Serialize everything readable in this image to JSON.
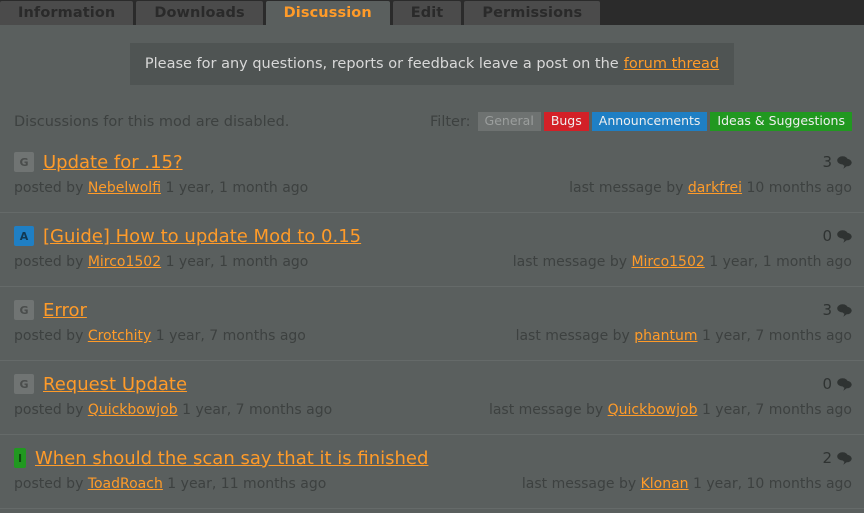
{
  "tabs": [
    {
      "label": "Information",
      "active": false
    },
    {
      "label": "Downloads",
      "active": false
    },
    {
      "label": "Discussion",
      "active": true
    },
    {
      "label": "Edit",
      "active": false
    },
    {
      "label": "Permissions",
      "active": false
    }
  ],
  "banner": {
    "text": "Please for any questions, reports or feedback leave a post on the",
    "link_text": "forum thread"
  },
  "filter": {
    "disabled_note": "Discussions for this mod are disabled.",
    "label": "Filter:",
    "tags": [
      {
        "label": "General",
        "kind": "general",
        "color": "#6e7271",
        "active": false
      },
      {
        "label": "Bugs",
        "kind": "bugs",
        "color": "#d32027",
        "active": true
      },
      {
        "label": "Announcements",
        "kind": "announce",
        "color": "#1f7fc4",
        "active": true
      },
      {
        "label": "Ideas & Suggestions",
        "kind": "ideas",
        "color": "#219820",
        "active": true
      }
    ]
  },
  "colors": {
    "accent": "#ff9b29",
    "page_bg": "#5a5f5e",
    "tabbar_bg": "#2b2b2b",
    "banner_bg": "#4f5453"
  },
  "threads": [
    {
      "badge": "G",
      "badge_kind": "g",
      "title": "Update for .15?",
      "posted_prefix": "posted by",
      "posted_user": "Nebelwolfi",
      "posted_time": "1 year, 1 month ago",
      "reply_count": "3",
      "last_prefix": "last message by",
      "last_user": "darkfrei",
      "last_time": "10 months ago"
    },
    {
      "badge": "A",
      "badge_kind": "a",
      "title": "[Guide] How to update Mod to 0.15",
      "posted_prefix": "posted by",
      "posted_user": "Mirco1502",
      "posted_time": "1 year, 1 month ago",
      "reply_count": "0",
      "last_prefix": "last message by",
      "last_user": "Mirco1502",
      "last_time": "1 year, 1 month ago"
    },
    {
      "badge": "G",
      "badge_kind": "g",
      "title": "Error",
      "posted_prefix": "posted by",
      "posted_user": "Crotchity",
      "posted_time": "1 year, 7 months ago",
      "reply_count": "3",
      "last_prefix": "last message by",
      "last_user": "phantum",
      "last_time": "1 year, 7 months ago"
    },
    {
      "badge": "G",
      "badge_kind": "g",
      "title": "Request Update",
      "posted_prefix": "posted by",
      "posted_user": "Quickbowjob",
      "posted_time": "1 year, 7 months ago",
      "reply_count": "0",
      "last_prefix": "last message by",
      "last_user": "Quickbowjob",
      "last_time": "1 year, 7 months ago"
    },
    {
      "badge": "I",
      "badge_kind": "i",
      "title": "When should the scan say that it is finished",
      "posted_prefix": "posted by",
      "posted_user": "ToadRoach",
      "posted_time": "1 year, 11 months ago",
      "reply_count": "2",
      "last_prefix": "last message by",
      "last_user": "Klonan",
      "last_time": "1 year, 10 months ago"
    }
  ],
  "icons": {
    "comment": "comment-bubble-icon"
  }
}
